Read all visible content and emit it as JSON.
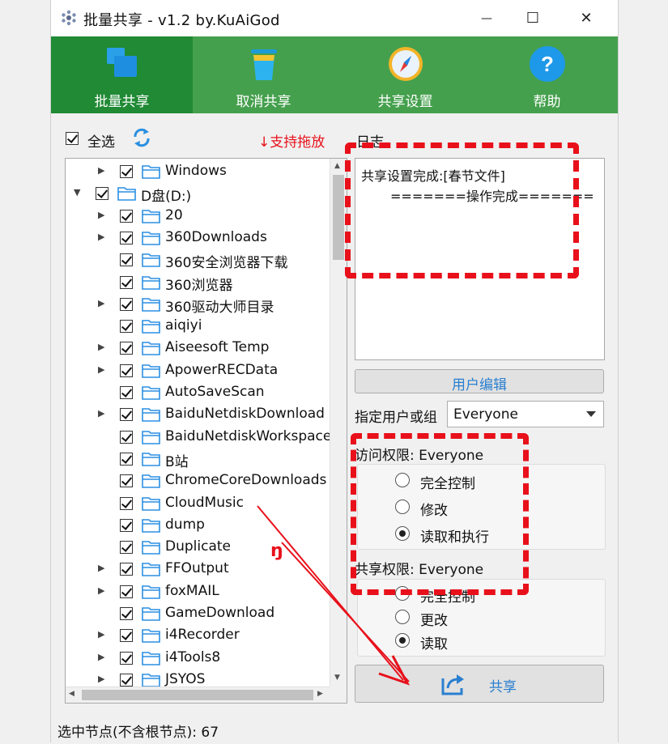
{
  "window": {
    "title": "批量共享 - v1.2 by.KuAiGod",
    "minimize_glyph": "—",
    "maximize_glyph": "☐",
    "close_glyph": "✕"
  },
  "toolbar": {
    "items": [
      {
        "label": "批量共享",
        "icon": "windows-share-icon",
        "active": true
      },
      {
        "label": "取消共享",
        "icon": "trash-can-icon",
        "active": false
      },
      {
        "label": "共享设置",
        "icon": "compass-icon",
        "active": false
      },
      {
        "label": "帮助",
        "icon": "help-icon",
        "active": false
      }
    ],
    "active_color": "#208a35",
    "bg_color": "#45a04d"
  },
  "select_all": {
    "label": "全选",
    "checked": true
  },
  "drag_hint": "↓支持拖放",
  "log": {
    "label": "日志",
    "lines": [
      "共享设置完成:[春节文件]",
      "=======操作完成======="
    ]
  },
  "tree": {
    "items": [
      {
        "name": "Windows",
        "expandable": true,
        "level": 1,
        "checked": true
      },
      {
        "name": "D盘(D:)",
        "expandable": true,
        "expanded": true,
        "level": 0,
        "checked": true
      },
      {
        "name": "20",
        "expandable": true,
        "level": 1,
        "checked": true
      },
      {
        "name": "360Downloads",
        "expandable": true,
        "level": 1,
        "checked": true
      },
      {
        "name": "360安全浏览器下载",
        "expandable": false,
        "level": 1,
        "checked": true
      },
      {
        "name": "360浏览器",
        "expandable": false,
        "level": 1,
        "checked": true
      },
      {
        "name": "360驱动大师目录",
        "expandable": true,
        "level": 1,
        "checked": true
      },
      {
        "name": "aiqiyi",
        "expandable": false,
        "level": 1,
        "checked": true
      },
      {
        "name": "Aiseesoft Temp",
        "expandable": true,
        "level": 1,
        "checked": true
      },
      {
        "name": "ApowerRECData",
        "expandable": true,
        "level": 1,
        "checked": true
      },
      {
        "name": "AutoSaveScan",
        "expandable": false,
        "level": 1,
        "checked": true
      },
      {
        "name": "BaiduNetdiskDownload",
        "expandable": true,
        "level": 1,
        "checked": true
      },
      {
        "name": "BaiduNetdiskWorkspace",
        "expandable": false,
        "level": 1,
        "checked": true
      },
      {
        "name": "B站",
        "expandable": false,
        "level": 1,
        "checked": true
      },
      {
        "name": "ChromeCoreDownloads",
        "expandable": false,
        "level": 1,
        "checked": true
      },
      {
        "name": "CloudMusic",
        "expandable": false,
        "level": 1,
        "checked": true
      },
      {
        "name": "dump",
        "expandable": false,
        "level": 1,
        "checked": true
      },
      {
        "name": "Duplicate",
        "expandable": false,
        "level": 1,
        "checked": true
      },
      {
        "name": "FFOutput",
        "expandable": true,
        "level": 1,
        "checked": true
      },
      {
        "name": "foxMAIL",
        "expandable": true,
        "level": 1,
        "checked": true
      },
      {
        "name": "GameDownload",
        "expandable": false,
        "level": 1,
        "checked": true
      },
      {
        "name": "i4Recorder",
        "expandable": true,
        "level": 1,
        "checked": true
      },
      {
        "name": "i4Tools8",
        "expandable": true,
        "level": 1,
        "checked": true
      },
      {
        "name": "JSYOS",
        "expandable": true,
        "level": 1,
        "checked": true
      }
    ]
  },
  "user_edit_button": "用户编辑",
  "assign": {
    "label": "指定用户或组",
    "selected": "Everyone"
  },
  "access": {
    "label": "访问权限: Everyone",
    "options": [
      "完全控制",
      "修改",
      "读取和执行"
    ],
    "selected_index": 2
  },
  "share": {
    "label": "共享权限: Everyone",
    "options": [
      "完全控制",
      "更改",
      "读取"
    ],
    "selected_index": 2
  },
  "share_button": "共享",
  "status": "选中节点(不含根节点): 67",
  "annotation_color": "#e8101a",
  "annotation_mark": "ŋ"
}
